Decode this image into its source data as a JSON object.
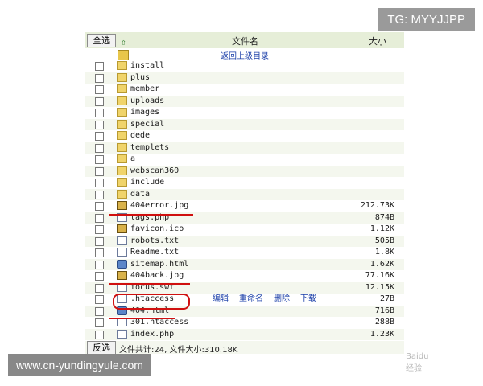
{
  "header": {
    "select_all": "全选",
    "filename_col": "文件名",
    "size_col": "大小",
    "up_dir": "返回上级目录"
  },
  "files": [
    {
      "name": "install",
      "type": "folder",
      "size": ""
    },
    {
      "name": "plus",
      "type": "folder",
      "size": ""
    },
    {
      "name": "member",
      "type": "folder",
      "size": ""
    },
    {
      "name": "uploads",
      "type": "folder",
      "size": ""
    },
    {
      "name": "images",
      "type": "folder",
      "size": ""
    },
    {
      "name": "special",
      "type": "folder",
      "size": ""
    },
    {
      "name": "dede",
      "type": "folder",
      "size": ""
    },
    {
      "name": "templets",
      "type": "folder",
      "size": ""
    },
    {
      "name": "a",
      "type": "folder",
      "size": ""
    },
    {
      "name": "webscan360",
      "type": "folder",
      "size": ""
    },
    {
      "name": "include",
      "type": "folder",
      "size": ""
    },
    {
      "name": "data",
      "type": "folder",
      "size": ""
    },
    {
      "name": "404error.jpg",
      "type": "image",
      "size": "212.73K"
    },
    {
      "name": "tags.php",
      "type": "file",
      "size": "874B"
    },
    {
      "name": "favicon.ico",
      "type": "image",
      "size": "1.12K"
    },
    {
      "name": "robots.txt",
      "type": "file",
      "size": "505B"
    },
    {
      "name": "Readme.txt",
      "type": "file",
      "size": "1.8K"
    },
    {
      "name": "sitemap.html",
      "type": "web",
      "size": "1.62K"
    },
    {
      "name": "404back.jpg",
      "type": "image",
      "size": "77.16K"
    },
    {
      "name": "focus.swf",
      "type": "file",
      "size": "12.15K"
    },
    {
      "name": ".htaccess",
      "type": "file",
      "size": "27B"
    },
    {
      "name": "404.html",
      "type": "web",
      "size": "716B"
    },
    {
      "name": "301.htaccess",
      "type": "file",
      "size": "288B"
    },
    {
      "name": "index.php",
      "type": "file",
      "size": "1.23K"
    }
  ],
  "row_actions": {
    "edit": "编辑",
    "rename": "重命名",
    "delete": "删除",
    "download": "下载"
  },
  "footer": {
    "invert": "反选",
    "summary": "文件共计:24, 文件大小:310.18K"
  },
  "overlay": {
    "tag": "TG: MYYJJPP",
    "site": "www.cn-yundingyule.com",
    "watermark": "Baidu经验"
  }
}
